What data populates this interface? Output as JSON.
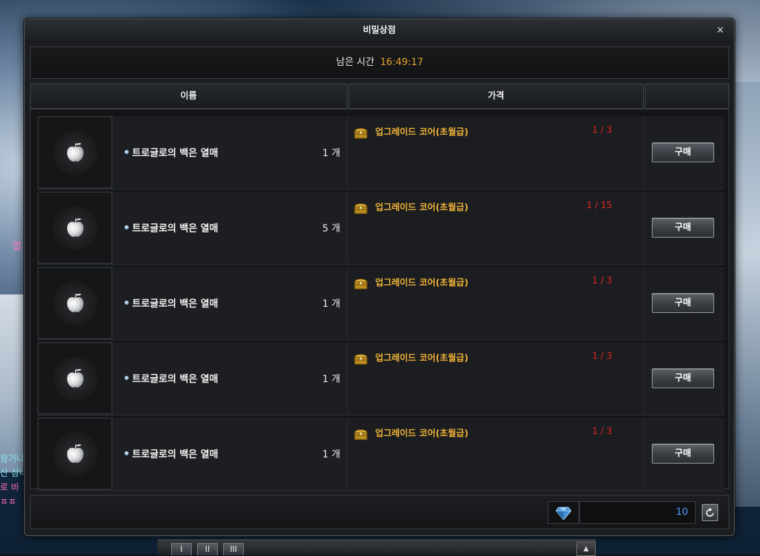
{
  "window": {
    "title": "비밀상점",
    "close_label": "×"
  },
  "timer": {
    "label": "남은 시간",
    "time": "16:49:17"
  },
  "columns": {
    "name": "이름",
    "price": "가격",
    "action": ""
  },
  "items": [
    {
      "name": "트로글로의 백은 열매",
      "qty": "1 개",
      "currency": "업그레이드 코어(초월급)",
      "stock": "1 / 3",
      "buy_label": "구매",
      "icon": "silver-apple-icon"
    },
    {
      "name": "트로글로의 백은 열매",
      "qty": "5 개",
      "currency": "업그레이드 코어(초월급)",
      "stock": "1 / 15",
      "buy_label": "구매",
      "icon": "silver-apple-icon"
    },
    {
      "name": "트로글로의 백은 열매",
      "qty": "1 개",
      "currency": "업그레이드 코어(초월급)",
      "stock": "1 / 3",
      "buy_label": "구매",
      "icon": "silver-apple-icon"
    },
    {
      "name": "트로글로의 백은 열매",
      "qty": "1 개",
      "currency": "업그레이드 코어(초월급)",
      "stock": "1 / 3",
      "buy_label": "구매",
      "icon": "silver-apple-icon"
    },
    {
      "name": "트로글로의 백은 열매",
      "qty": "1 개",
      "currency": "업그레이드 코어(초월급)",
      "stock": "1 / 3",
      "buy_label": "구매",
      "icon": "silver-apple-icon"
    }
  ],
  "footer": {
    "currency_icon": "blue-gem-icon",
    "amount": "10",
    "refresh_icon": "refresh-icon"
  },
  "hotbar": {
    "tabs": [
      "I",
      "II",
      "III"
    ],
    "arrow": "▲"
  },
  "background_chat": [
    "참거나",
    "산 삼니",
    "로 바",
    "ㅍㅍ"
  ],
  "background_note": "열",
  "colors": {
    "timer_value": "#e9a531",
    "currency_name": "#f0b337",
    "stock": "#e0261f",
    "amount": "#5aa0ff"
  }
}
